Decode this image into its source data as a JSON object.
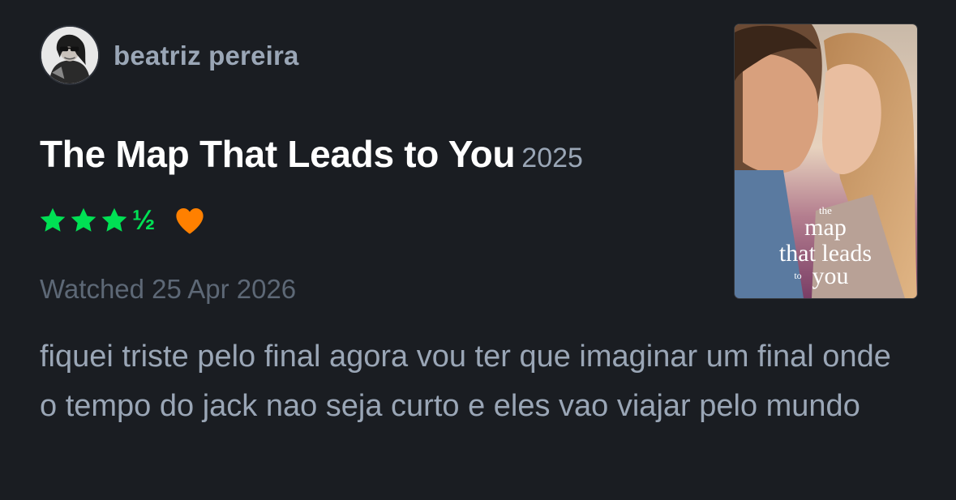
{
  "user": {
    "name": "beatriz pereira",
    "avatar_icon": "user-avatar-photo"
  },
  "film": {
    "title": "The Map That Leads to You",
    "year": "2025",
    "poster": {
      "line1": "the",
      "line2": "map",
      "line3": "that leads",
      "line4_small": "to",
      "line4": "you"
    }
  },
  "rating": {
    "stars": 3.5,
    "half_glyph": "½",
    "liked": true,
    "star_color": "#00e054",
    "heart_color": "#ff8000"
  },
  "watched_text": "Watched 25 Apr 2026",
  "review_text": "fiquei triste pelo final agora vou ter que imaginar um final onde o tempo do jack nao seja curto e eles vao viajar pelo mundo"
}
